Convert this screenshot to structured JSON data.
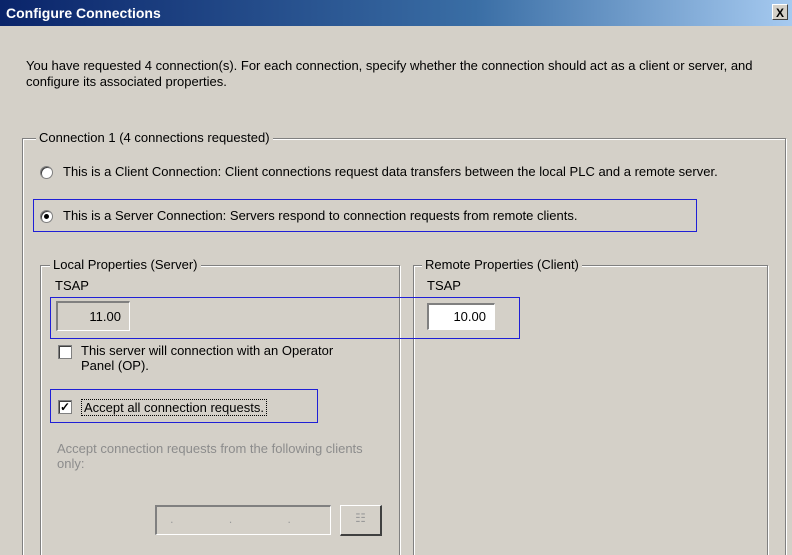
{
  "window": {
    "title": "Configure Connections",
    "close_glyph": "X"
  },
  "intro": "You have requested 4 connection(s).  For each connection, specify whether the connection should act as a client or server, and configure its associated properties.",
  "connection_group": {
    "label": "Connection 1 (4 connections requested)"
  },
  "client_option": {
    "text": "This is a Client Connection: Client connections request data transfers between the local PLC and a remote server.",
    "selected": false
  },
  "server_option": {
    "text": "This is a Server Connection: Servers respond to connection requests from remote clients.",
    "selected": true
  },
  "local": {
    "label": "Local Properties (Server)",
    "tsap_label": "TSAP",
    "tsap_value": "11.00",
    "op_text": "This server will connection with an Operator Panel (OP).",
    "op_checked": false,
    "accept_all_text": "Accept all connection requests.",
    "accept_all_checked": true,
    "accept_from_text": "Accept connection requests from the following clients only:",
    "ip_placeholder": ". . .",
    "address_button_glyph": "☷"
  },
  "remote": {
    "label": "Remote Properties (Client)",
    "tsap_label": "TSAP",
    "tsap_value": "10.00"
  },
  "colors": {
    "highlight": "#1f1fd6",
    "titlebar": "#0a246a",
    "background": "#d4d0c8"
  }
}
